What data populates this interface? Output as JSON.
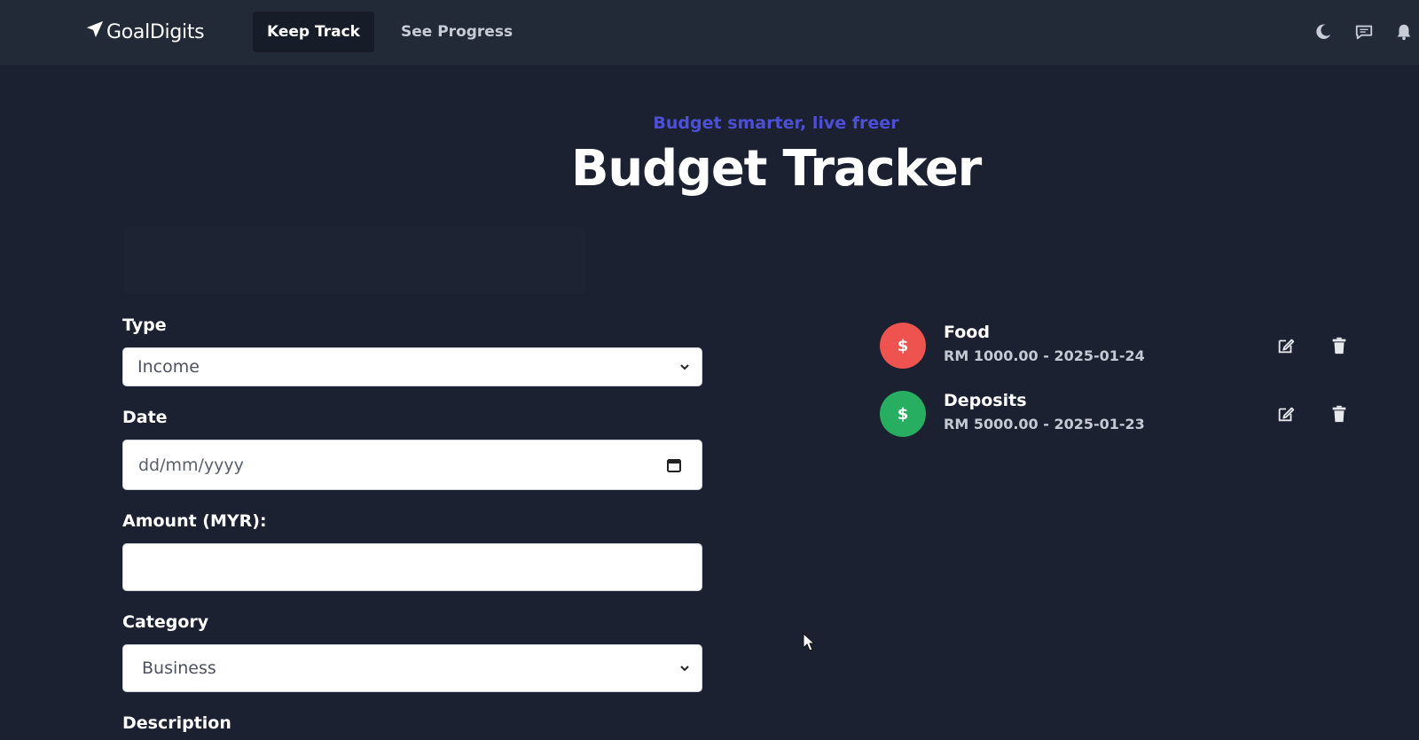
{
  "nav": {
    "brand": "GoalDigits",
    "links": [
      {
        "label": "Keep Track",
        "active": true
      },
      {
        "label": "See Progress",
        "active": false
      }
    ],
    "icons": [
      "moon-icon",
      "chat-icon",
      "bell-icon"
    ]
  },
  "hero": {
    "tagline": "Budget smarter, live freer",
    "title": "Budget Tracker"
  },
  "form": {
    "type_label": "Type",
    "type_value": "Income",
    "date_label": "Date",
    "date_placeholder": "dd/mm/yyyy",
    "amount_label": "Amount (MYR):",
    "amount_value": "",
    "category_label": "Category",
    "category_value": "Business",
    "description_label": "Description"
  },
  "transactions": [
    {
      "name": "Food",
      "detail": "RM 1000.00 - 2025-01-24",
      "kind": "expense",
      "symbol": "$"
    },
    {
      "name": "Deposits",
      "detail": "RM 5000.00 - 2025-01-23",
      "kind": "income",
      "symbol": "$"
    }
  ],
  "colors": {
    "background": "#1b2130",
    "navbar": "#222a38",
    "tagline": "#4d4fd6",
    "expense": "#ef5350",
    "income": "#27ae60"
  }
}
